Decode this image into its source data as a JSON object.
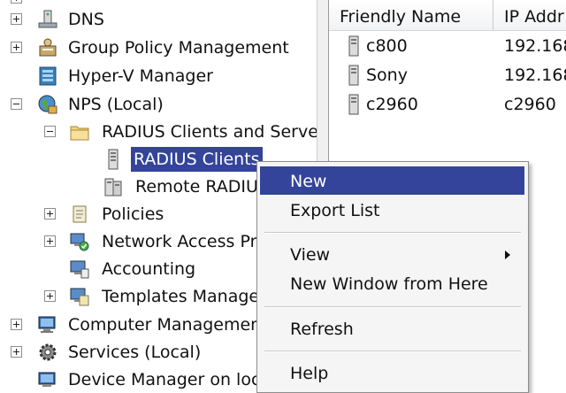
{
  "tree": {
    "items": [
      {
        "label": "DNS",
        "icon": "dns-icon",
        "expander": "plus"
      },
      {
        "label": "Group Policy Management",
        "icon": "group-policy-icon",
        "expander": "plus"
      },
      {
        "label": "Hyper-V Manager",
        "icon": "hyperv-icon",
        "expander": "none"
      },
      {
        "label": "NPS (Local)",
        "icon": "nps-globe-icon",
        "expander": "minus"
      },
      {
        "label": "RADIUS Clients and Serve",
        "icon": "folder-icon",
        "expander": "minus"
      },
      {
        "label": "RADIUS Clients",
        "icon": "server-icon",
        "expander": "none",
        "selected": true
      },
      {
        "label": "Remote RADIU",
        "icon": "server-group-icon",
        "expander": "none"
      },
      {
        "label": "Policies",
        "icon": "policies-scroll-icon",
        "expander": "plus"
      },
      {
        "label": "Network Access Pr",
        "icon": "network-access-icon",
        "expander": "plus"
      },
      {
        "label": "Accounting",
        "icon": "accounting-icon",
        "expander": "none"
      },
      {
        "label": "Templates Manage",
        "icon": "templates-icon",
        "expander": "plus"
      },
      {
        "label": "Computer Managemen",
        "icon": "computer-management-icon",
        "expander": "plus"
      },
      {
        "label": "Services (Local)",
        "icon": "services-gear-icon",
        "expander": "plus"
      },
      {
        "label": "Device Manager on loc",
        "icon": "device-manager-icon",
        "expander": "none"
      }
    ]
  },
  "list": {
    "columns": [
      "Friendly Name",
      "IP Addr"
    ],
    "rows": [
      {
        "name": "c800",
        "ip": "192.168"
      },
      {
        "name": "Sony",
        "ip": "192.168"
      },
      {
        "name": "c2960",
        "ip": "c2960"
      }
    ]
  },
  "context_menu": {
    "items": [
      "New",
      "Export List",
      "View",
      "New Window from Here",
      "Refresh",
      "Help"
    ],
    "highlighted": "New",
    "submenu_items": [
      "View"
    ]
  },
  "colors": {
    "selection": "#33449a",
    "menu_background": "#f5f5f5"
  }
}
